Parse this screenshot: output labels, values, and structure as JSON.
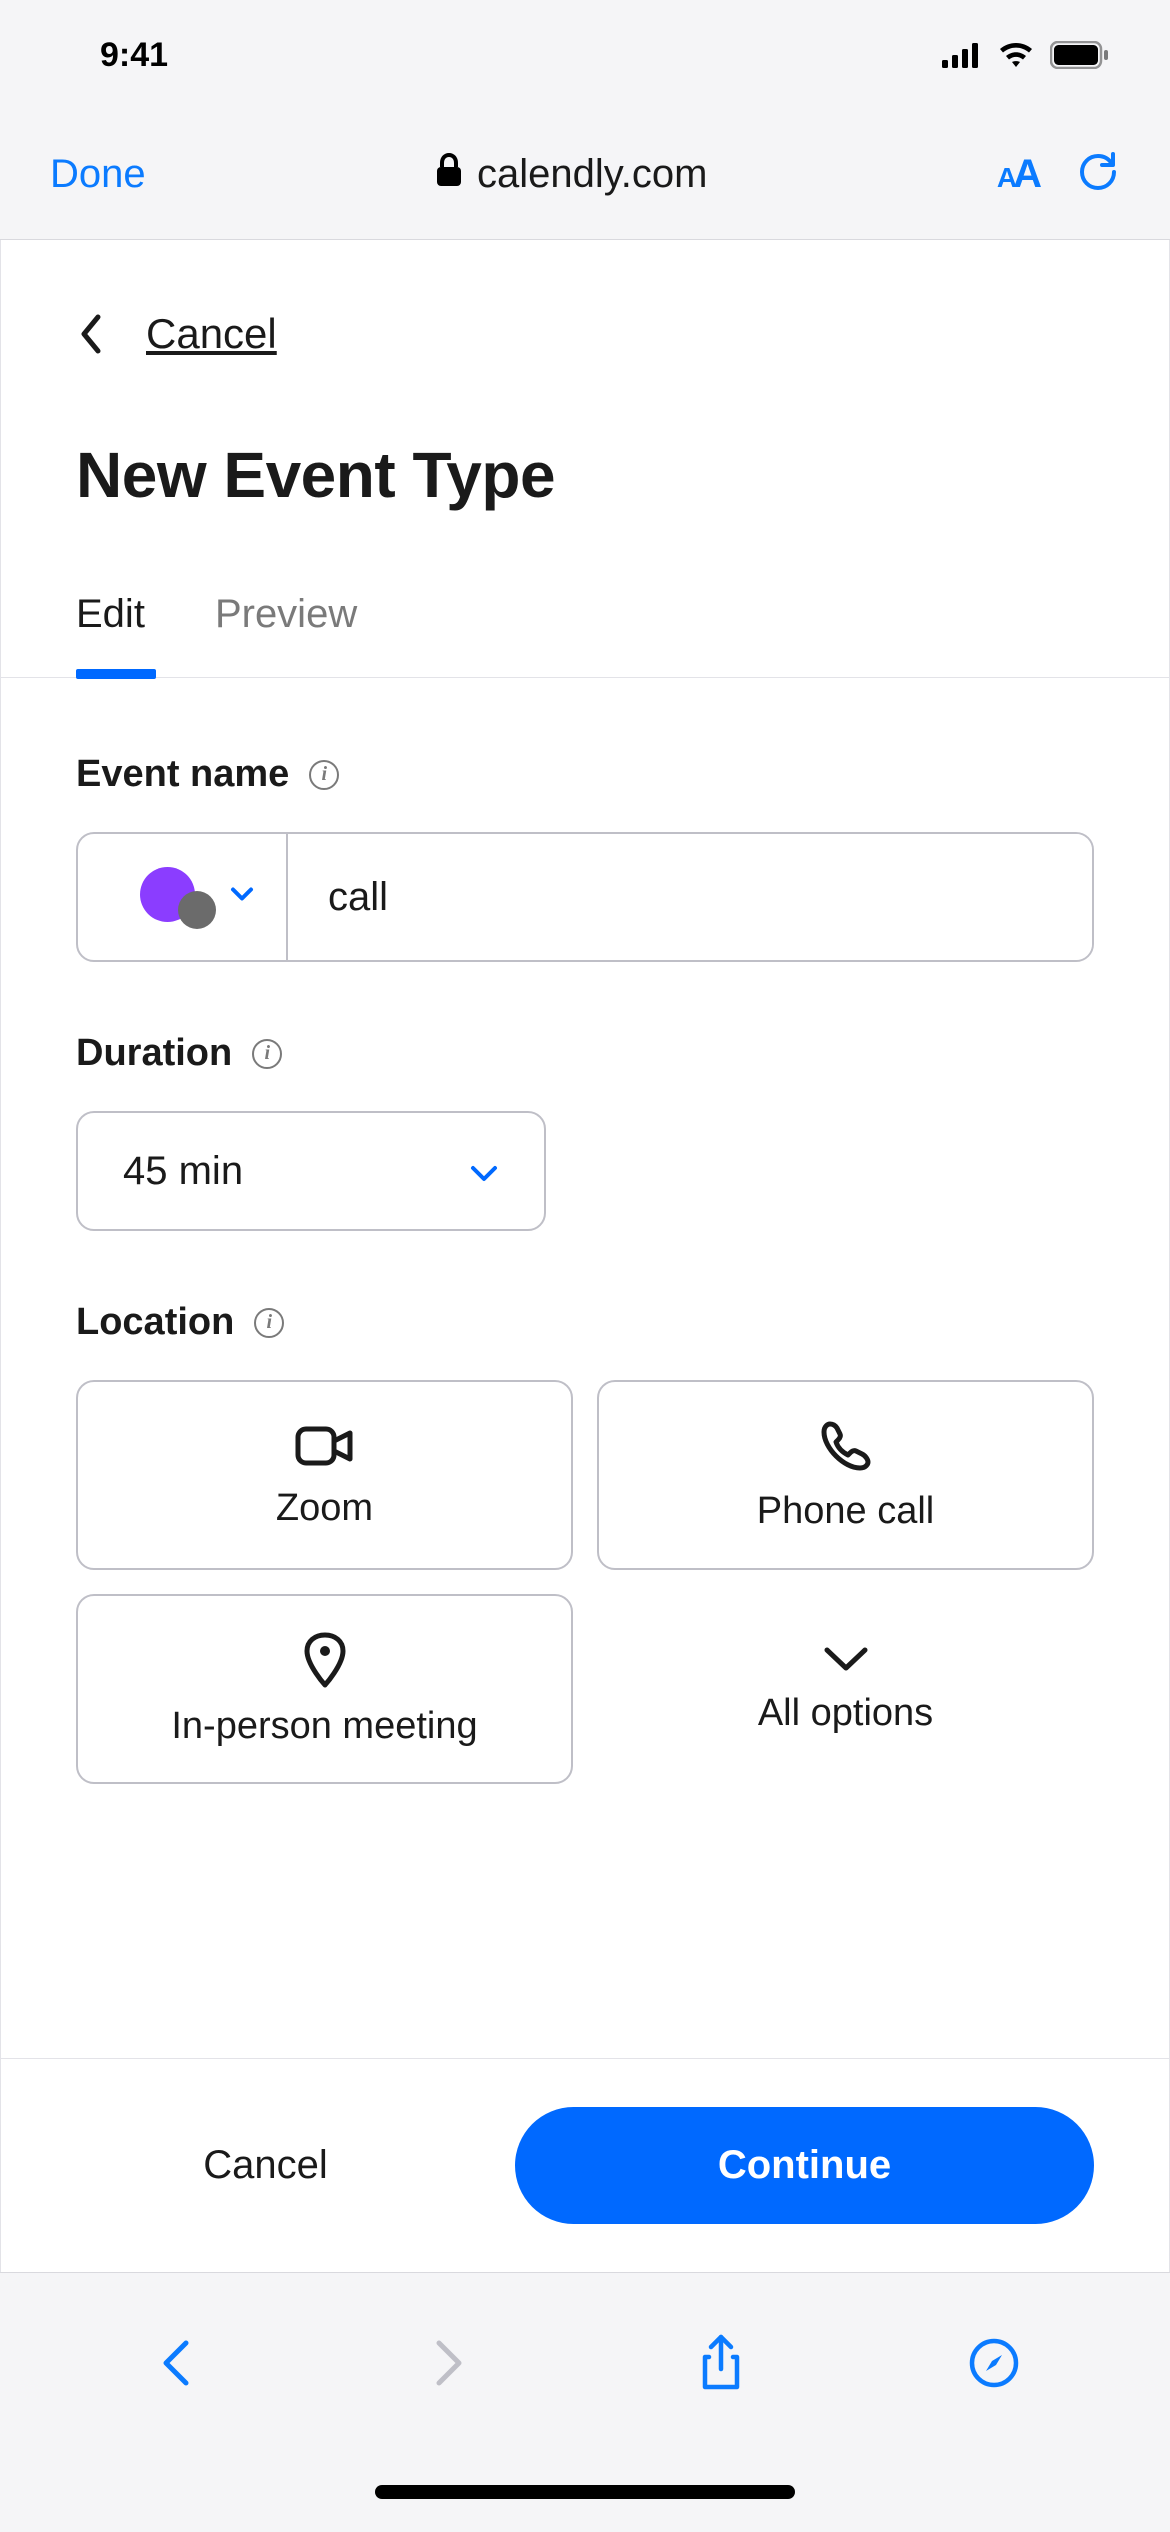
{
  "status": {
    "time": "9:41"
  },
  "safari": {
    "done": "Done",
    "url": "calendly.com"
  },
  "header": {
    "cancel": "Cancel",
    "title": "New Event Type"
  },
  "tabs": {
    "edit": "Edit",
    "preview": "Preview"
  },
  "form": {
    "event_name": {
      "label": "Event name",
      "value": "call",
      "color": "#8b3dff"
    },
    "duration": {
      "label": "Duration",
      "value": "45 min"
    },
    "location": {
      "label": "Location",
      "options": {
        "zoom": "Zoom",
        "phone": "Phone call",
        "inperson": "In-person meeting",
        "all": "All options"
      }
    }
  },
  "footer": {
    "cancel": "Cancel",
    "continue": "Continue"
  }
}
